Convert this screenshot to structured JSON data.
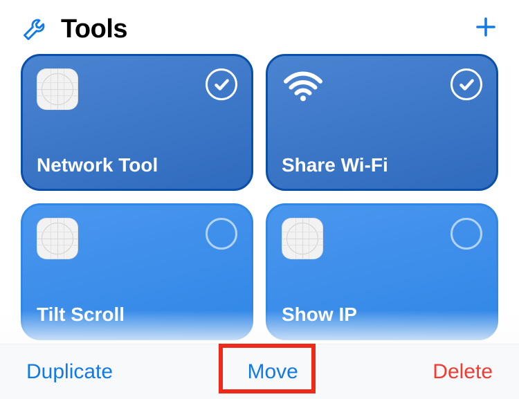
{
  "header": {
    "title": "Tools"
  },
  "cards": [
    {
      "title": "Network Tool",
      "selected": true,
      "icon": "app"
    },
    {
      "title": "Share Wi-Fi",
      "selected": true,
      "icon": "wifi"
    },
    {
      "title": "Tilt Scroll",
      "selected": false,
      "icon": "app"
    },
    {
      "title": "Show IP",
      "selected": false,
      "icon": "app"
    }
  ],
  "toolbar": {
    "duplicate": "Duplicate",
    "move": "Move",
    "delete": "Delete"
  },
  "colors": {
    "accent": "#1179e8",
    "destructive": "#ef3b30",
    "highlight": "#ee2a1b"
  }
}
